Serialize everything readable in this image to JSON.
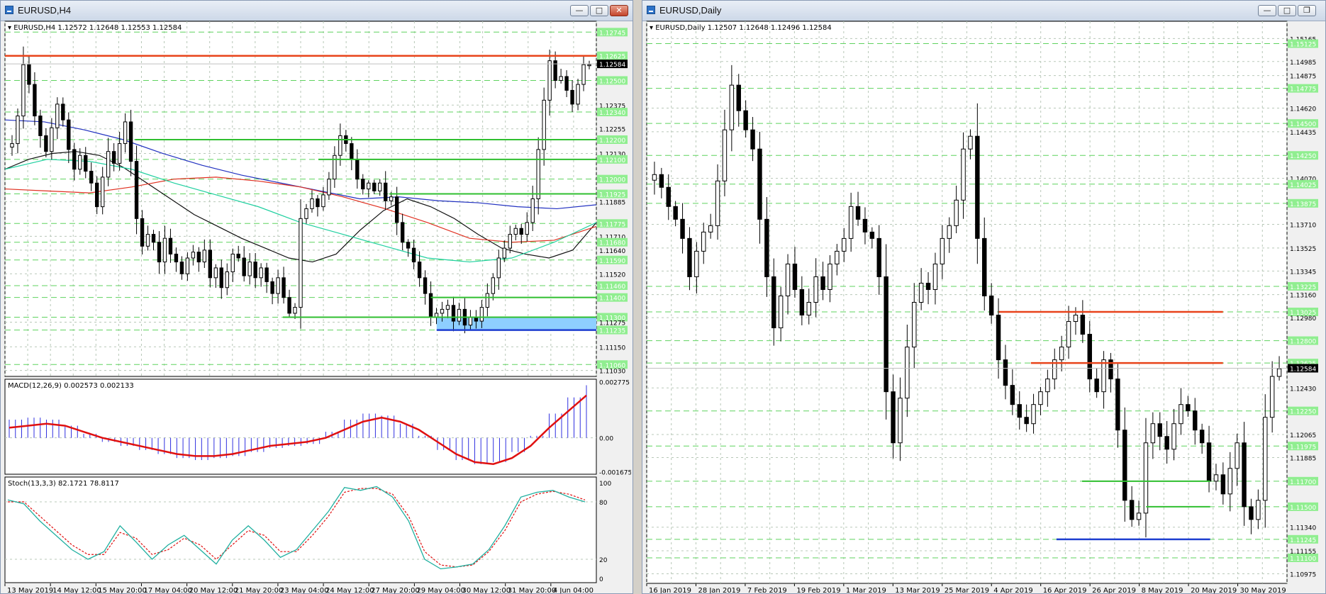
{
  "windows": {
    "left": {
      "title": "EURUSD,H4"
    },
    "right": {
      "title": "EURUSD,Daily"
    }
  },
  "icons": {
    "minimize": "minimize-icon",
    "maximize": "maximize-icon",
    "close": "close-icon"
  },
  "colors": {
    "bull": "#ffffff",
    "bear": "#000000",
    "resistance": "#e8431a",
    "support_green": "#2fbf2f",
    "support_blue": "#1f3fd0",
    "macd_line": "#e01010",
    "macd_hist": "#3030e0",
    "stoch_main": "#20b0a0",
    "stoch_signal": "#e01010",
    "ma_black": "#101010",
    "ma_blue": "#2030c0",
    "ma_red": "#e03020",
    "ma_teal": "#20d0a0",
    "label_bg": "#90ee90",
    "grid": "#b8c8b8",
    "current_price_bg": "#000000"
  },
  "chart_data": [
    {
      "id": "h4",
      "type": "candlestick",
      "symbol_header": "EURUSD,H4  1.12572 1.12648 1.12553 1.12584",
      "current_price": "1.12584",
      "ylim": [
        1.11,
        1.128
      ],
      "y_ticks": [
        "1.12745",
        "1.12625",
        "1.12500",
        "1.12375",
        "1.12340",
        "1.12255",
        "1.12200",
        "1.12130",
        "1.12100",
        "1.12000",
        "1.11925",
        "1.11885",
        "1.11775",
        "1.11710",
        "1.11680",
        "1.11640",
        "1.11590",
        "1.11520",
        "1.11460",
        "1.11400",
        "1.11300",
        "1.11275",
        "1.11235",
        "1.11150",
        "1.11060",
        "1.11030"
      ],
      "green_labels": [
        "1.12745",
        "1.12625",
        "1.12500",
        "1.12340",
        "1.12200",
        "1.12100",
        "1.12000",
        "1.11925",
        "1.11775",
        "1.11680",
        "1.11590",
        "1.11460",
        "1.11400",
        "1.11300",
        "1.11235",
        "1.11060"
      ],
      "x_labels": [
        "13 May 2019",
        "14 May 12:00",
        "15 May 20:00",
        "17 May 04:00",
        "20 May 12:00",
        "21 May 20:00",
        "23 May 04:00",
        "24 May 12:00",
        "27 May 20:00",
        "29 May 04:00",
        "30 May 12:00",
        "31 May 20:00",
        "4 Jun 04:00"
      ],
      "closes": [
        1.1218,
        1.1232,
        1.1258,
        1.1248,
        1.1232,
        1.1222,
        1.1214,
        1.1226,
        1.1238,
        1.123,
        1.1215,
        1.1205,
        1.1212,
        1.1204,
        1.1198,
        1.1186,
        1.1201,
        1.1214,
        1.1208,
        1.1218,
        1.1229,
        1.1209,
        1.118,
        1.1166,
        1.1172,
        1.1168,
        1.1158,
        1.117,
        1.1162,
        1.1158,
        1.1152,
        1.116,
        1.1163,
        1.1158,
        1.1164,
        1.115,
        1.1155,
        1.1145,
        1.1153,
        1.1162,
        1.116,
        1.1151,
        1.1158,
        1.115,
        1.1155,
        1.1148,
        1.1142,
        1.115,
        1.114,
        1.1132,
        1.1135,
        1.118,
        1.1185,
        1.119,
        1.1186,
        1.1192,
        1.12,
        1.1212,
        1.1222,
        1.1218,
        1.121,
        1.12,
        1.1195,
        1.1198,
        1.1194,
        1.1198,
        1.1189,
        1.1191,
        1.1178,
        1.1168,
        1.1165,
        1.1158,
        1.115,
        1.1142,
        1.113,
        1.1132,
        1.1134,
        1.1136,
        1.1128,
        1.1134,
        1.1126,
        1.113,
        1.1128,
        1.1135,
        1.1142,
        1.115,
        1.116,
        1.1165,
        1.1172,
        1.1175,
        1.1172,
        1.1178,
        1.119,
        1.1215,
        1.124,
        1.126,
        1.125,
        1.1252,
        1.1245,
        1.1238,
        1.1248,
        1.1258,
        1.1258
      ],
      "ma_black": {
        "start": 0,
        "values": [
          1.1205,
          1.121,
          1.1213,
          1.1214,
          1.1212,
          1.1206,
          1.1198,
          1.119,
          1.1182,
          1.1176,
          1.117,
          1.1165,
          1.116,
          1.1158,
          1.1162,
          1.1174,
          1.1184,
          1.119,
          1.1186,
          1.118,
          1.1172,
          1.1165,
          1.1162,
          1.116,
          1.1164,
          1.1178
        ]
      },
      "ma_blue": {
        "start": 0,
        "values": [
          1.123,
          1.1229,
          1.1225,
          1.122,
          1.1213,
          1.1207,
          1.1202,
          1.1198,
          1.1194,
          1.119,
          1.1191,
          1.1189,
          1.1188,
          1.1186,
          1.1185,
          1.1187
        ]
      },
      "ma_red": {
        "start": 0,
        "values": [
          1.1195,
          1.1194,
          1.1193,
          1.1196,
          1.12,
          1.1201,
          1.1199,
          1.1196,
          1.1191,
          1.1185,
          1.1178,
          1.117,
          1.1168,
          1.1169,
          1.1176
        ]
      },
      "ma_teal": {
        "start": 0,
        "values": [
          1.1205,
          1.121,
          1.1209,
          1.1205,
          1.1198,
          1.1192,
          1.1186,
          1.1178,
          1.1172,
          1.1166,
          1.116,
          1.1158,
          1.116,
          1.1168,
          1.1178
        ]
      },
      "resistance": [
        {
          "price": 1.12625,
          "from": 0.0,
          "to": 1.0
        }
      ],
      "support_green": [
        {
          "price": 1.122,
          "from": 0.22,
          "to": 1.0
        },
        {
          "price": 1.121,
          "from": 0.53,
          "to": 1.0
        },
        {
          "price": 1.11925,
          "from": 0.65,
          "to": 1.0
        },
        {
          "price": 1.114,
          "from": 0.72,
          "to": 1.0
        },
        {
          "price": 1.113,
          "from": 0.47,
          "to": 1.0
        }
      ],
      "support_blue": [
        {
          "price": 1.11235,
          "from": 0.73,
          "to": 1.0
        }
      ],
      "zone": {
        "from_price": 1.113,
        "to_price": 1.11235,
        "from": 0.73,
        "to": 1.0
      },
      "macd": {
        "header": "MACD(12,26,9) 0.002573 0.002133",
        "labels": [
          "0.002775",
          "0.00",
          "-0.001675"
        ],
        "ylim": [
          -0.0018,
          0.0029
        ],
        "signal": [
          0.0005,
          0.0006,
          0.0007,
          0.0006,
          0.0003,
          0.0,
          -0.0002,
          -0.0004,
          -0.0006,
          -0.0008,
          -0.0009,
          -0.0009,
          -0.0008,
          -0.0006,
          -0.0004,
          -0.0003,
          -0.0002,
          0.0,
          0.0004,
          0.0008,
          0.001,
          0.0008,
          0.0004,
          -0.0002,
          -0.0008,
          -0.0012,
          -0.0013,
          -0.001,
          -0.0004,
          0.0005,
          0.0013,
          0.0021
        ],
        "hist": [
          0.0009,
          0.001,
          0.0009,
          0.0006,
          0.0002,
          -0.0002,
          -0.0004,
          -0.0006,
          -0.0008,
          -0.001,
          -0.0011,
          -0.001,
          -0.0009,
          -0.0007,
          -0.0005,
          -0.0004,
          -0.0003,
          0.0003,
          0.0009,
          0.0012,
          0.0011,
          0.0007,
          0.0001,
          -0.0006,
          -0.0011,
          -0.0013,
          -0.0012,
          -0.0007,
          0.0001,
          0.0012,
          0.002,
          0.0026
        ]
      },
      "stoch": {
        "header": "Stoch(13,3,3) 82.1721 78.8117",
        "labels": [
          "100",
          "80",
          "20",
          "0"
        ],
        "main": [
          82,
          78,
          60,
          45,
          30,
          20,
          28,
          55,
          38,
          20,
          35,
          45,
          30,
          15,
          40,
          55,
          40,
          22,
          30,
          50,
          70,
          95,
          92,
          96,
          85,
          60,
          20,
          10,
          12,
          15,
          30,
          55,
          85,
          90,
          92,
          85,
          80
        ],
        "signal": [
          80,
          80,
          65,
          50,
          35,
          25,
          25,
          48,
          42,
          25,
          30,
          42,
          35,
          20,
          35,
          50,
          45,
          28,
          28,
          45,
          65,
          90,
          94,
          94,
          88,
          65,
          28,
          14,
          12,
          14,
          28,
          50,
          80,
          88,
          91,
          88,
          82
        ]
      }
    },
    {
      "id": "daily",
      "type": "candlestick",
      "symbol_header": "EURUSD,Daily  1.12507 1.12648 1.12496 1.12584",
      "current_price": "1.12584",
      "ylim": [
        1.109,
        1.153
      ],
      "y_ticks": [
        "1.15165",
        "1.15125",
        "1.14985",
        "1.14875",
        "1.14775",
        "1.14620",
        "1.14500",
        "1.14435",
        "1.14250",
        "1.14070",
        "1.14025",
        "1.13875",
        "1.13710",
        "1.13525",
        "1.13345",
        "1.13225",
        "1.13160",
        "1.13025",
        "1.12980",
        "1.12800",
        "1.12625",
        "1.12430",
        "1.12250",
        "1.12065",
        "1.11975",
        "1.11885",
        "1.11700",
        "1.11500",
        "1.11340",
        "1.11245",
        "1.11155",
        "1.11100",
        "1.10975"
      ],
      "green_labels": [
        "1.15125",
        "1.14775",
        "1.14500",
        "1.14250",
        "1.14025",
        "1.13875",
        "1.13225",
        "1.13025",
        "1.12800",
        "1.12625",
        "1.12250",
        "1.11975",
        "1.11700",
        "1.11500",
        "1.11245",
        "1.11100"
      ],
      "x_labels": [
        "16 Jan 2019",
        "28 Jan 2019",
        "7 Feb 2019",
        "19 Feb 2019",
        "1 Mar 2019",
        "13 Mar 2019",
        "25 Mar 2019",
        "4 Apr 2019",
        "16 Apr 2019",
        "26 Apr 2019",
        "8 May 2019",
        "20 May 2019",
        "30 May 2019"
      ],
      "closes": [
        1.141,
        1.14,
        1.1385,
        1.1375,
        1.136,
        1.133,
        1.135,
        1.1365,
        1.137,
        1.1405,
        1.1445,
        1.148,
        1.146,
        1.1445,
        1.143,
        1.1375,
        1.133,
        1.129,
        1.1315,
        1.134,
        1.132,
        1.13,
        1.131,
        1.133,
        1.132,
        1.134,
        1.135,
        1.136,
        1.1385,
        1.1375,
        1.1365,
        1.136,
        1.133,
        1.124,
        1.12,
        1.1235,
        1.1275,
        1.131,
        1.1325,
        1.132,
        1.134,
        1.136,
        1.137,
        1.139,
        1.143,
        1.144,
        1.136,
        1.1315,
        1.13,
        1.1265,
        1.1245,
        1.123,
        1.122,
        1.1215,
        1.123,
        1.124,
        1.125,
        1.1265,
        1.1275,
        1.1295,
        1.13,
        1.1285,
        1.125,
        1.124,
        1.1265,
        1.125,
        1.121,
        1.1155,
        1.114,
        1.1145,
        1.12,
        1.1215,
        1.1205,
        1.1195,
        1.1215,
        1.123,
        1.1225,
        1.121,
        1.12,
        1.117,
        1.1175,
        1.116,
        1.118,
        1.12,
        1.115,
        1.114,
        1.1155,
        1.122,
        1.1252,
        1.1258
      ],
      "resistance": [
        {
          "price": 1.13025,
          "from": 0.55,
          "to": 0.9
        },
        {
          "price": 1.12625,
          "from": 0.6,
          "to": 0.9
        }
      ],
      "support_green": [
        {
          "price": 1.117,
          "from": 0.68,
          "to": 0.88
        },
        {
          "price": 1.115,
          "from": 0.78,
          "to": 0.88
        }
      ],
      "support_blue": [
        {
          "price": 1.11245,
          "from": 0.64,
          "to": 0.88
        }
      ]
    }
  ]
}
